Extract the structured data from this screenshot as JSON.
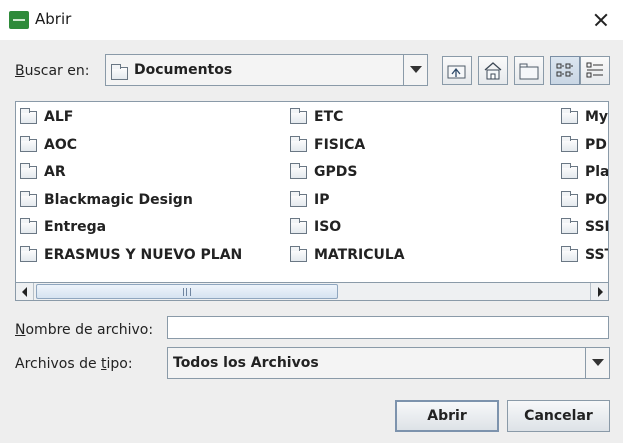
{
  "window": {
    "title": "Abrir",
    "close_icon": "close-icon",
    "app_icon": "java-app-icon"
  },
  "lookin": {
    "label_prefix": "",
    "label_mnemonic": "B",
    "label_rest": "uscar en:",
    "value": "Documentos"
  },
  "toolbar": {
    "buttons": [
      "up-one-level-icon",
      "home-icon",
      "new-folder-icon",
      "list-view-icon",
      "details-view-icon"
    ],
    "active": "list-view-icon"
  },
  "files": {
    "columns": [
      [
        "ALF",
        "AOC",
        "AR",
        "Blackmagic Design",
        "Entrega",
        "ERASMUS Y NUEVO PLAN"
      ],
      [
        "ETC",
        "FISICA",
        "GPDS",
        "IP",
        "ISO",
        "MATRICULA"
      ],
      [
        "My",
        "PD",
        "Pla",
        "PO",
        "SSI",
        "SST"
      ]
    ]
  },
  "filename": {
    "label_mnemonic": "N",
    "label_rest": "ombre de archivo:",
    "value": ""
  },
  "filetype": {
    "label_prefix": "Archivos de ",
    "label_mnemonic": "t",
    "label_rest": "ipo:",
    "value": "Todos los Archivos"
  },
  "buttons": {
    "open": "Abrir",
    "cancel": "Cancelar"
  },
  "colors": {
    "dialog_bg": "#eeeeee",
    "border": "#8a9aa8",
    "app_icon": "#2e8b3a"
  }
}
